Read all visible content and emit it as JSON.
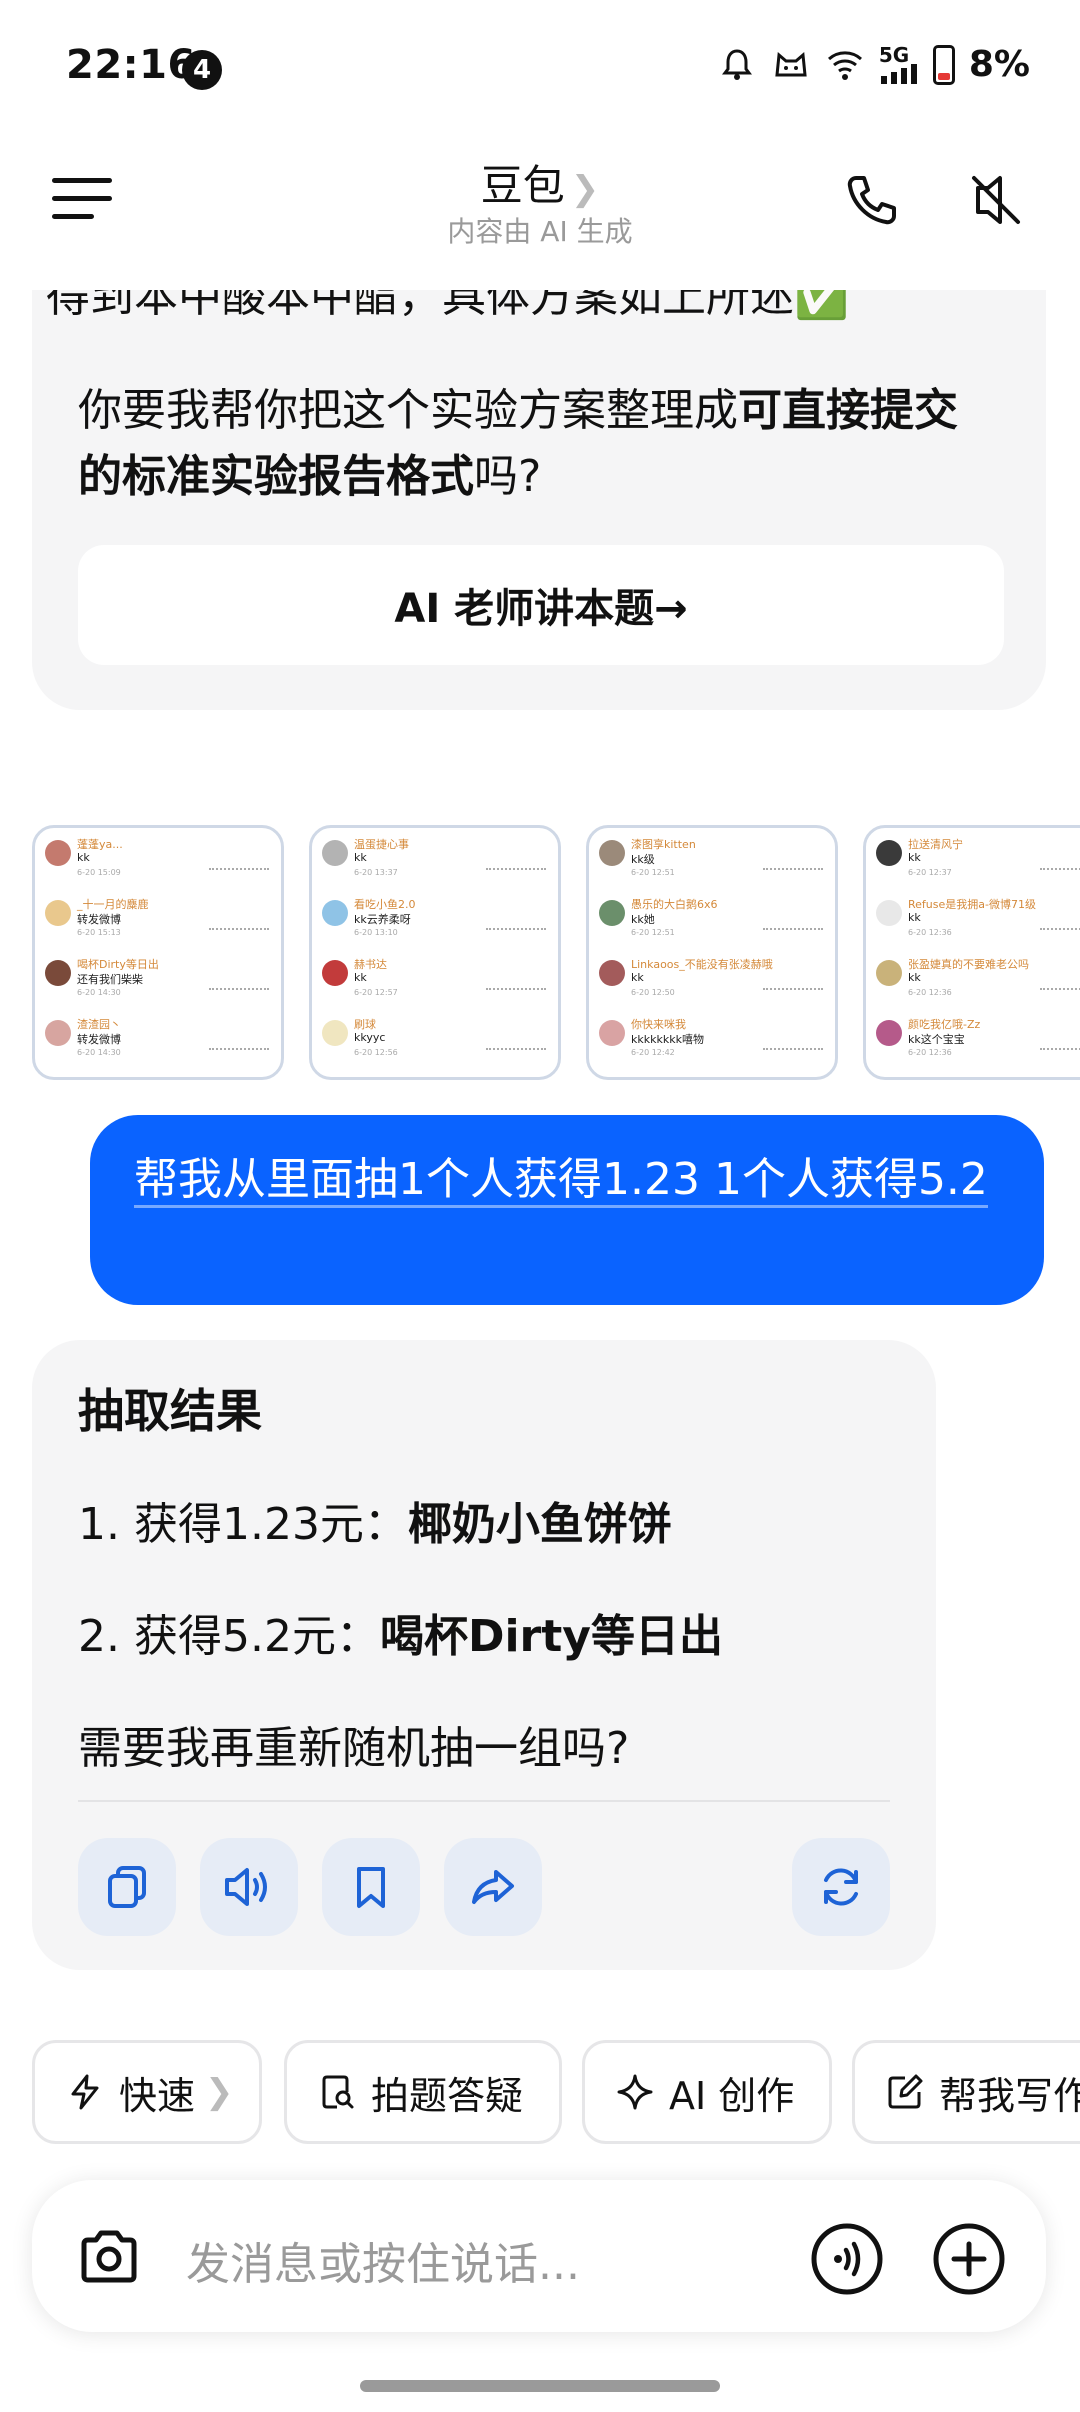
{
  "status_bar": {
    "time": "22:16",
    "notification_count": "4",
    "network": "5G",
    "battery": "8%"
  },
  "header": {
    "title": "豆包",
    "subtitle": "内容由 AI 生成"
  },
  "chat": {
    "ai_previous": {
      "cut_line": "得到本中酸本中酯，具体方案如上所述✅",
      "paragraph_prefix": "你要我帮你把这个实验方案整理成",
      "paragraph_bold": "可直接提交的标准实验报告格式",
      "paragraph_suffix": "吗?",
      "teacher_button": "AI 老师讲本题→"
    },
    "thumbnails": [
      {
        "rows": [
          {
            "name": "蓬蓬ya...",
            "text": "kk",
            "date": "6-20 15:09",
            "color": "#c47a6e"
          },
          {
            "name": "_十一月的麋鹿",
            "text": "转发微博",
            "date": "6-20 15:13",
            "color": "#e9c88d"
          },
          {
            "name": "喝杯Dirty等日出",
            "text": "还有我们柴柴",
            "date": "6-20 14:30",
            "color": "#7a4a3a"
          },
          {
            "name": "渣渣园丶",
            "text": "转发微博",
            "date": "6-20 14:30",
            "color": "#d7a5a0"
          }
        ]
      },
      {
        "rows": [
          {
            "name": "温蛋捷心事",
            "text": "kk",
            "date": "6-20 13:37",
            "color": "#b3b3b3"
          },
          {
            "name": "看吃小鱼2.0",
            "text": "kk云养柔呀",
            "date": "6-20 13:10",
            "color": "#8fc3e6"
          },
          {
            "name": "赫书达",
            "text": "kk",
            "date": "6-20 12:57",
            "color": "#c23b3b"
          },
          {
            "name": "刷球",
            "text": "kkyyc",
            "date": "6-20 12:56",
            "color": "#f0e6c0"
          }
        ]
      },
      {
        "rows": [
          {
            "name": "漆图享kitten",
            "text": "kk级",
            "date": "6-20 12:51",
            "color": "#9b8a7a"
          },
          {
            "name": "愚乐的大白鹅6x6",
            "text": "kk她",
            "date": "6-20 12:51",
            "color": "#6b8f6b"
          },
          {
            "name": "Linkaoos_不能没有张凌赫哦",
            "text": "kk",
            "date": "6-20 12:50",
            "color": "#a35b5b"
          },
          {
            "name": "你快来咪我",
            "text": "kkkkkkkk嘻物",
            "date": "6-20 12:42",
            "color": "#d9a3a3"
          }
        ]
      },
      {
        "rows": [
          {
            "name": "拉送清风宁",
            "text": "kk",
            "date": "6-20 12:37",
            "color": "#3a3a3a"
          },
          {
            "name": "Refuse是我拥a-微博71级",
            "text": "kk",
            "date": "6-20 12:36",
            "color": "#e8e8e8"
          },
          {
            "name": "张盈婕真的不要难老公吗",
            "text": "kk",
            "date": "6-20 12:36",
            "color": "#c9b27a"
          },
          {
            "name": "颜吃我亿哦-Zz",
            "text": "kk这个宝宝",
            "date": "6-20 12:36",
            "color": "#b55a8a"
          }
        ]
      }
    ],
    "user_message": "帮我从里面抽1个人获得1.23 1个人获得5.2",
    "result": {
      "title": "抽取结果",
      "line1_prefix": "1. 获得1.23元：",
      "line1_winner": "椰奶小鱼饼饼",
      "line2_prefix": "2. 获得5.2元：",
      "line2_winner": "喝杯Dirty等日出",
      "question": "需要我再重新随机抽一组吗?",
      "actions": [
        "copy-icon",
        "speaker-icon",
        "bookmark-icon",
        "share-icon",
        "regenerate-icon"
      ]
    }
  },
  "quick_chips": [
    {
      "label": "快速",
      "icon": "lightning-icon"
    },
    {
      "label": "拍题答疑",
      "icon": "photo-search-icon"
    },
    {
      "label": "AI 创作",
      "icon": "sparkle-icon"
    },
    {
      "label": "帮我写作",
      "icon": "edit-icon"
    }
  ],
  "input": {
    "placeholder": "发消息或按住说话..."
  },
  "colors": {
    "accent": "#0a63ff",
    "card_bg": "#f5f5f6",
    "action_bg": "#e6ecf6",
    "action_icon": "#1e63d6"
  }
}
